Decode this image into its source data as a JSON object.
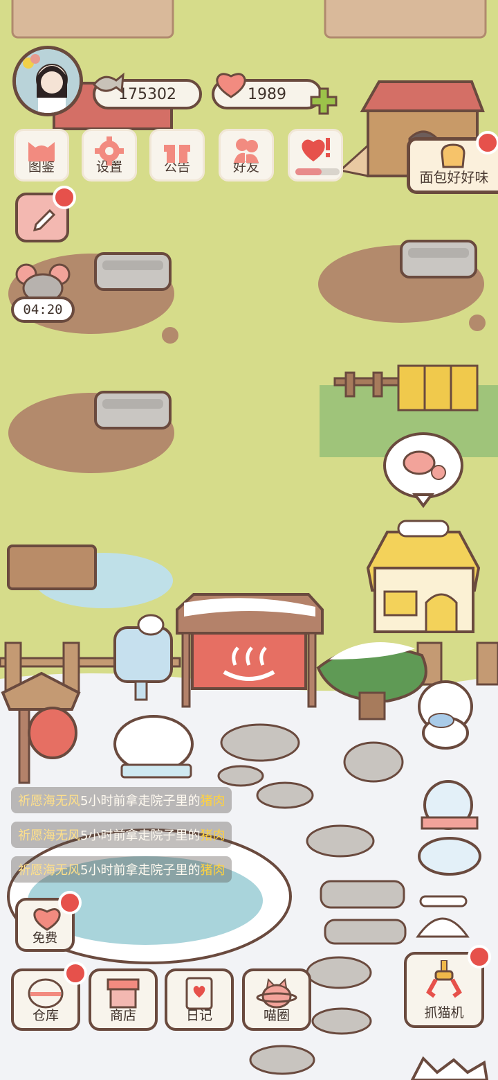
{
  "currencies": {
    "fish": "175302",
    "hearts": "1989"
  },
  "top_menu": [
    {
      "label": "图鉴",
      "icon": "cat-head-icon"
    },
    {
      "label": "设置",
      "icon": "gear-icon"
    },
    {
      "label": "公告",
      "icon": "gift-icon"
    },
    {
      "label": "好友",
      "icon": "friends-icon"
    },
    {
      "label": "",
      "icon": "heart-chat-icon"
    }
  ],
  "event_sign": {
    "label": "面包好好味",
    "icon": "bread-icon"
  },
  "mouse_timer": "04:20",
  "feed": {
    "line1": {
      "name": "祈愿海无风",
      "mid": "5小时前拿走院子里的",
      "item": "猪肉"
    },
    "line2": {
      "name": "祈愿海无风",
      "mid": "5小时前拿走院子里的",
      "item": "猪肉"
    },
    "line3": {
      "name": "祈愿海无风",
      "mid": "5小时前拿走院子里的",
      "item": "猪肉"
    }
  },
  "free_button": "免费",
  "bottom_menu": [
    {
      "label": "仓库",
      "icon": "warehouse-icon"
    },
    {
      "label": "商店",
      "icon": "shop-icon"
    },
    {
      "label": "日记",
      "icon": "diary-icon"
    },
    {
      "label": "喵圈",
      "icon": "cat-planet-icon"
    }
  ],
  "claw_machine": "抓猫机",
  "colors": {
    "grass": "#d6dc8a",
    "snow": "#f2f3f6",
    "outline": "#6a4a3e",
    "accent_red": "#e6514b",
    "highlight_yellow": "#ffd23f"
  }
}
